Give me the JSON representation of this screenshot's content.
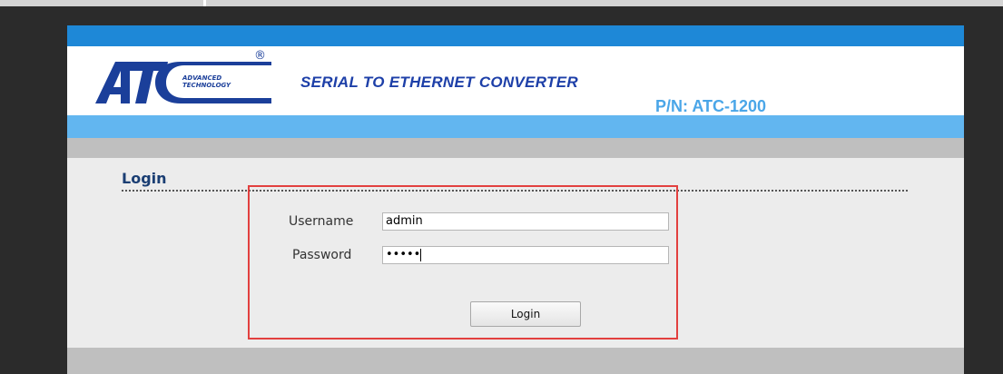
{
  "header": {
    "brand_sub_line1": "ADVANCED",
    "brand_sub_line2": "TECHNOLOGY",
    "registered_mark": "®",
    "title": "SERIAL TO ETHERNET CONVERTER",
    "part_number": "P/N: ATC-1200"
  },
  "login": {
    "heading": "Login",
    "username_label": "Username",
    "username_value": "admin",
    "password_label": "Password",
    "password_value": "•••••",
    "button_label": "Login"
  },
  "colors": {
    "blue_band": "#1e88d7",
    "light_blue_band": "#62b6f0",
    "gray_band": "#bfbfbf",
    "title_blue": "#1d3fa8",
    "part_number_blue": "#4aa6e8",
    "highlight_red": "#e2403f"
  }
}
